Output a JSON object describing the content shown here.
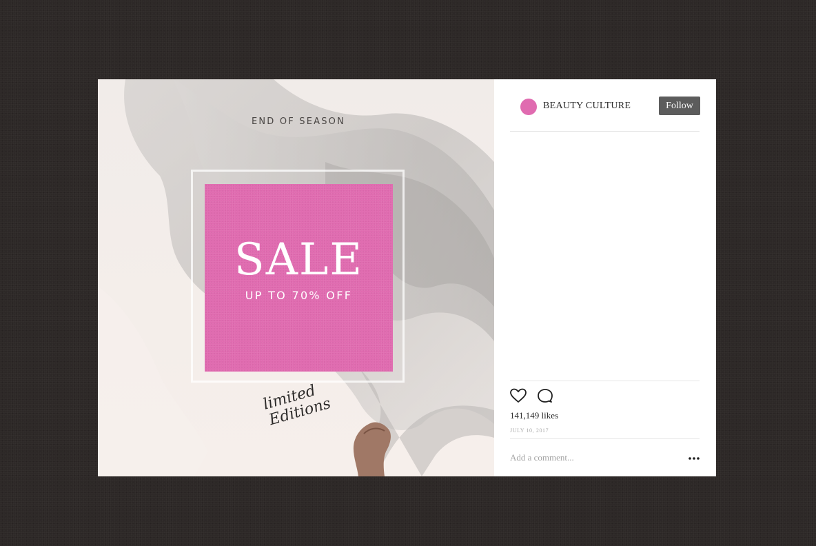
{
  "post": {
    "eyebrow": "END OF SEASON",
    "headline": "SALE",
    "subheadline": "UP TO 70% OFF",
    "script_line1": "limited",
    "script_line2": "Editions"
  },
  "account": {
    "username": "BEAUTY CULTURE",
    "avatar_color": "#e06bb0",
    "follow_label": "Follow"
  },
  "actions": {
    "like_icon": "heart-icon",
    "comment_icon": "comment-bubble-icon",
    "likes_text": "141,149 likes",
    "date_text": "JULY 10, 2017"
  },
  "comment": {
    "placeholder": "Add a comment...",
    "more_icon": "more-options-icon"
  },
  "colors": {
    "accent": "#e06bb0",
    "background": "#2d2827",
    "follow_button": "#5c5c5c"
  }
}
